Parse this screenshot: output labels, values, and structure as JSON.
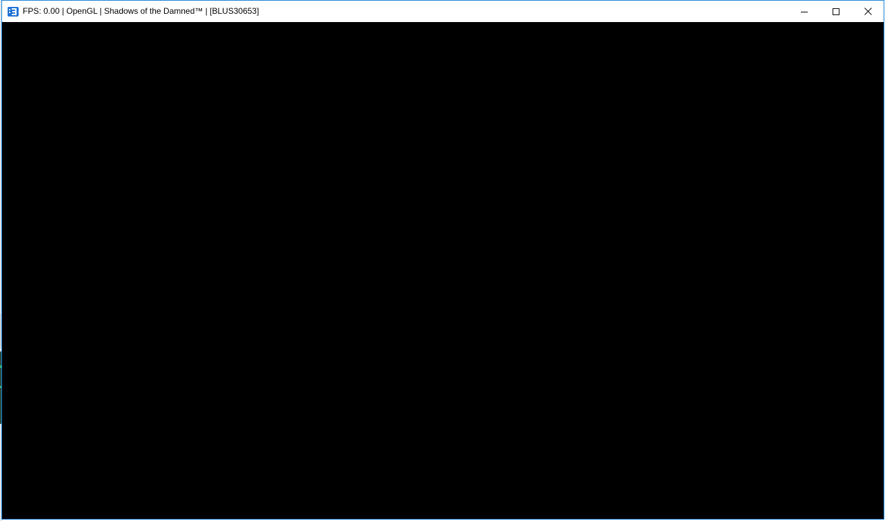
{
  "window": {
    "title": "FPS: 0.00 | OpenGL | Shadows of the Damned™ | [BLUS30653]",
    "app_icon": "rpcs3-app-icon",
    "controls": {
      "minimize_icon": "minimize-icon",
      "maximize_icon": "maximize-icon",
      "close_icon": "close-icon"
    },
    "content": "black-render-area"
  },
  "colors": {
    "accent_border": "#1883d7",
    "icon_blue": "#1f73d6",
    "titlebar_bg": "#ffffff",
    "client_bg": "#000000"
  }
}
